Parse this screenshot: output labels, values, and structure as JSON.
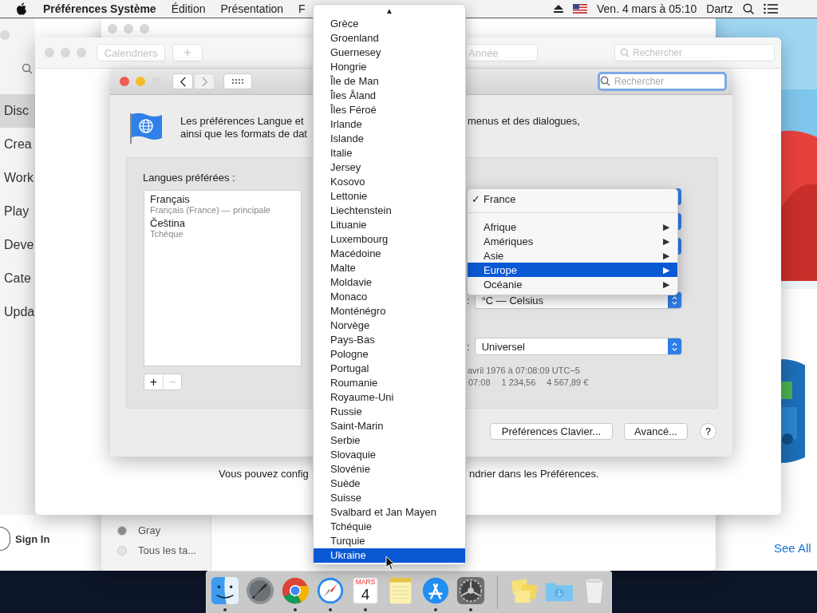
{
  "menu_bar": {
    "app": "Préférences Système",
    "menus": [
      "Édition",
      "Présentation",
      "F"
    ],
    "clock": "Ven. 4 mars à 05:10",
    "user": "Dartz"
  },
  "app_store_window": {
    "sidebar_items": [
      {
        "label": "Disc",
        "selected": true
      },
      {
        "label": "Crea",
        "selected": false
      },
      {
        "label": "Work",
        "selected": false
      },
      {
        "label": "Play",
        "selected": false
      },
      {
        "label": "Deve",
        "selected": false
      },
      {
        "label": "Cate",
        "selected": false
      },
      {
        "label": "Upda",
        "selected": false
      }
    ],
    "sign_in": "Sign In",
    "see_all": "See All"
  },
  "back_window": {
    "sidebar_items": [
      {
        "label": "Gray",
        "color": "#8e8e8e"
      },
      {
        "label": "Tous les ta...",
        "color": "#e4e4e4"
      }
    ]
  },
  "calendar_window": {
    "toolbar_buttons": [
      "Calendriers",
      "+",
      "Année"
    ],
    "search_placeholder": "Rechercher",
    "footer_left": "Vous pouvez config",
    "footer_right": "ndrier dans les Préférences."
  },
  "language_window": {
    "search_placeholder": "Rechercher",
    "nav_buttons": [
      {
        "kind": "back",
        "disabled": false
      },
      {
        "kind": "forward",
        "disabled": true
      }
    ],
    "description": [
      "Les préférences Langue et",
      "menus et des dialogues,",
      "ainsi que les formats de dat"
    ],
    "languages_label": "Langues préférées :",
    "languages": [
      {
        "name": "Français",
        "detail": "Français (France) — principale"
      },
      {
        "name": "Čeština",
        "detail": "Tchèque"
      }
    ],
    "list_buttons": [
      {
        "label": "+",
        "disabled": false
      },
      {
        "label": "−",
        "disabled": true
      }
    ],
    "popups": [
      {
        "label": ":",
        "value": "°C — Celsius"
      },
      {
        "label": ":",
        "value": "Universel"
      }
    ],
    "sample_date": "avril 1976 à 07:08:09 UTC−5",
    "sample_values": [
      "07:08",
      "1 234,56",
      "4 567,89 €"
    ],
    "buttons": [
      "Préférences Clavier...",
      "Avancé..."
    ],
    "help": "?"
  },
  "region_menu": {
    "items": [
      {
        "kind": "check",
        "label": "France",
        "check_mark": "✓",
        "checked": true,
        "selected": false
      },
      {
        "kind": "separator"
      },
      {
        "kind": "submenu",
        "label": "Afrique",
        "arrow": "▶",
        "selected": false
      },
      {
        "kind": "submenu",
        "label": "Amériques",
        "arrow": "▶",
        "selected": false
      },
      {
        "kind": "submenu",
        "label": "Asie",
        "arrow": "▶",
        "selected": false
      },
      {
        "kind": "submenu",
        "label": "Europe",
        "arrow": "▶",
        "selected": true
      },
      {
        "kind": "submenu",
        "label": "Océanie",
        "arrow": "▶",
        "selected": false
      }
    ]
  },
  "country_menu": {
    "scroll_arrow": "▲",
    "items": [
      {
        "label": "Grèce",
        "selected": false
      },
      {
        "label": "Groenland",
        "selected": false
      },
      {
        "label": "Guernesey",
        "selected": false
      },
      {
        "label": "Hongrie",
        "selected": false
      },
      {
        "label": "Île de Man",
        "selected": false
      },
      {
        "label": "Îles Åland",
        "selected": false
      },
      {
        "label": "Îles Féroé",
        "selected": false
      },
      {
        "label": "Irlande",
        "selected": false
      },
      {
        "label": "Islande",
        "selected": false
      },
      {
        "label": "Italie",
        "selected": false
      },
      {
        "label": "Jersey",
        "selected": false
      },
      {
        "label": "Kosovo",
        "selected": false
      },
      {
        "label": "Lettonie",
        "selected": false
      },
      {
        "label": "Liechtenstein",
        "selected": false
      },
      {
        "label": "Lituanie",
        "selected": false
      },
      {
        "label": "Luxembourg",
        "selected": false
      },
      {
        "label": "Macédoine",
        "selected": false
      },
      {
        "label": "Malte",
        "selected": false
      },
      {
        "label": "Moldavie",
        "selected": false
      },
      {
        "label": "Monaco",
        "selected": false
      },
      {
        "label": "Monténégro",
        "selected": false
      },
      {
        "label": "Norvège",
        "selected": false
      },
      {
        "label": "Pays-Bas",
        "selected": false
      },
      {
        "label": "Pologne",
        "selected": false
      },
      {
        "label": "Portugal",
        "selected": false
      },
      {
        "label": "Roumanie",
        "selected": false
      },
      {
        "label": "Royaume-Uni",
        "selected": false
      },
      {
        "label": "Russie",
        "selected": false
      },
      {
        "label": "Saint-Marin",
        "selected": false
      },
      {
        "label": "Serbie",
        "selected": false
      },
      {
        "label": "Slovaquie",
        "selected": false
      },
      {
        "label": "Slovénie",
        "selected": false
      },
      {
        "label": "Suède",
        "selected": false
      },
      {
        "label": "Suisse",
        "selected": false
      },
      {
        "label": "Svalbard et Jan Mayen",
        "selected": false
      },
      {
        "label": "Tchéquie",
        "selected": false
      },
      {
        "label": "Turquie",
        "selected": false
      },
      {
        "label": "Ukraine",
        "selected": true
      }
    ]
  },
  "dock": {
    "apps": [
      {
        "kind": "finder",
        "running": true
      },
      {
        "kind": "launchpad",
        "running": false
      },
      {
        "kind": "chrome",
        "running": true
      },
      {
        "kind": "safari",
        "running": true
      },
      {
        "kind": "calendar",
        "running": true,
        "month": "MARS",
        "day": "4"
      },
      {
        "kind": "notes",
        "running": false
      },
      {
        "kind": "appstore",
        "running": true
      },
      {
        "kind": "settings",
        "running": true
      }
    ],
    "others": [
      {
        "kind": "stickies",
        "running": false
      },
      {
        "kind": "downloads",
        "running": false
      },
      {
        "kind": "trash",
        "running": false
      }
    ]
  }
}
